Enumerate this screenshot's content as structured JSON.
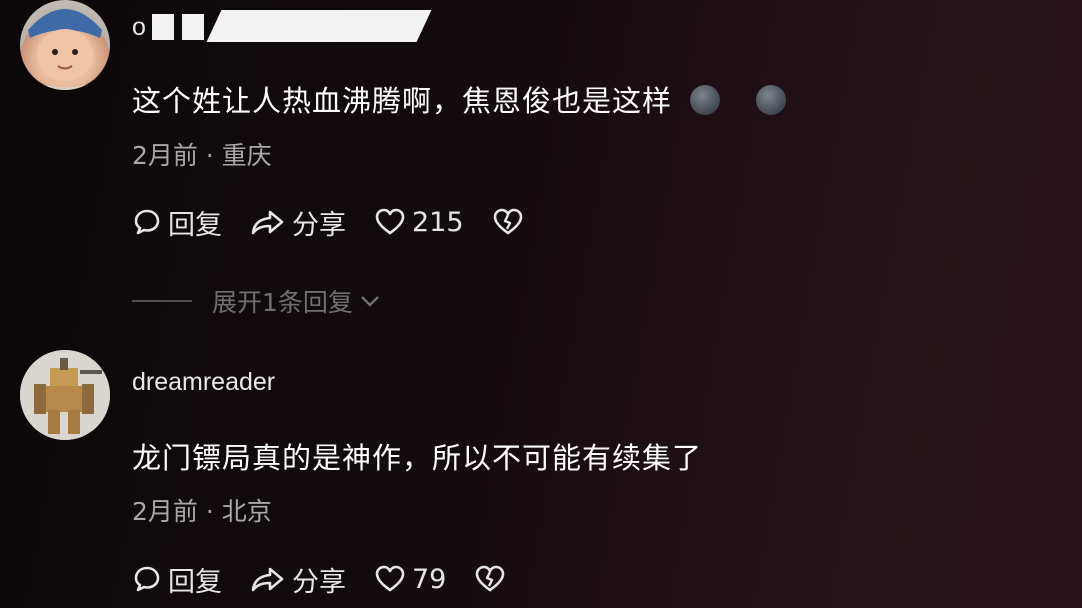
{
  "comments": [
    {
      "username": "o",
      "text": "这个姓让人热血沸腾啊，焦恩俊也是这样",
      "meta": "2月前 · 重庆",
      "reply_label": "回复",
      "share_label": "分享",
      "likes": "215",
      "expand_label": "展开1条回复"
    },
    {
      "username": "dreamreader",
      "text": "龙门镖局真的是神作，所以不可能有续集了",
      "meta": "2月前 · 北京",
      "reply_label": "回复",
      "share_label": "分享",
      "likes": "79"
    }
  ]
}
